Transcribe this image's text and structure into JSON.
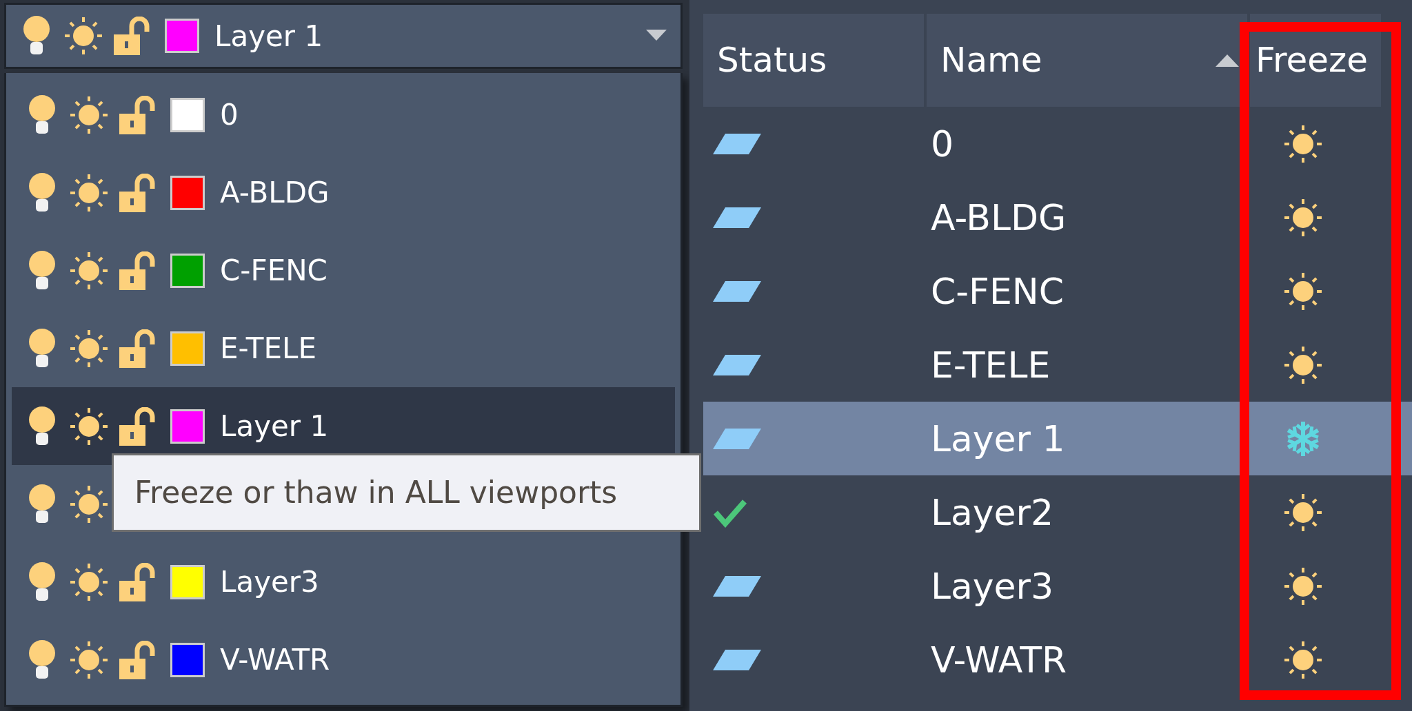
{
  "layer_combo": {
    "name": "Layer 1",
    "color": "#ff00ff",
    "on": true,
    "frozen": false,
    "locked": false
  },
  "layer_list": [
    {
      "name": "0",
      "color": "#ffffff",
      "on": true,
      "frozen": false,
      "locked": false,
      "selected": false
    },
    {
      "name": "A-BLDG",
      "color": "#ff0000",
      "on": true,
      "frozen": false,
      "locked": false,
      "selected": false
    },
    {
      "name": "C-FENC",
      "color": "#00a000",
      "on": true,
      "frozen": false,
      "locked": false,
      "selected": false
    },
    {
      "name": "E-TELE",
      "color": "#ffbf00",
      "on": true,
      "frozen": false,
      "locked": false,
      "selected": false
    },
    {
      "name": "Layer 1",
      "color": "#ff00ff",
      "on": true,
      "frozen": false,
      "locked": false,
      "selected": true
    },
    {
      "on": true,
      "frozen": false,
      "selected": false
    },
    {
      "name": "Layer3",
      "color": "#ffff00",
      "on": true,
      "frozen": false,
      "locked": false,
      "selected": false
    },
    {
      "name": "V-WATR",
      "color": "#0000ff",
      "on": true,
      "frozen": false,
      "locked": false,
      "selected": false
    }
  ],
  "tooltip": "Freeze or thaw in ALL viewports",
  "table": {
    "columns": [
      "Status",
      "Name",
      "Freeze"
    ],
    "sort_ascending": true,
    "rows": [
      {
        "current": false,
        "name": "0",
        "frozen": false,
        "selected": false
      },
      {
        "current": false,
        "name": "A-BLDG",
        "frozen": false,
        "selected": false
      },
      {
        "current": false,
        "name": "C-FENC",
        "frozen": false,
        "selected": false
      },
      {
        "current": false,
        "name": "E-TELE",
        "frozen": false,
        "selected": false
      },
      {
        "current": false,
        "name": "Layer 1",
        "frozen": true,
        "selected": true
      },
      {
        "current": true,
        "name": "Layer2",
        "frozen": false,
        "selected": false
      },
      {
        "current": false,
        "name": "Layer3",
        "frozen": false,
        "selected": false
      },
      {
        "current": false,
        "name": "V-WATR",
        "frozen": false,
        "selected": false
      }
    ]
  }
}
